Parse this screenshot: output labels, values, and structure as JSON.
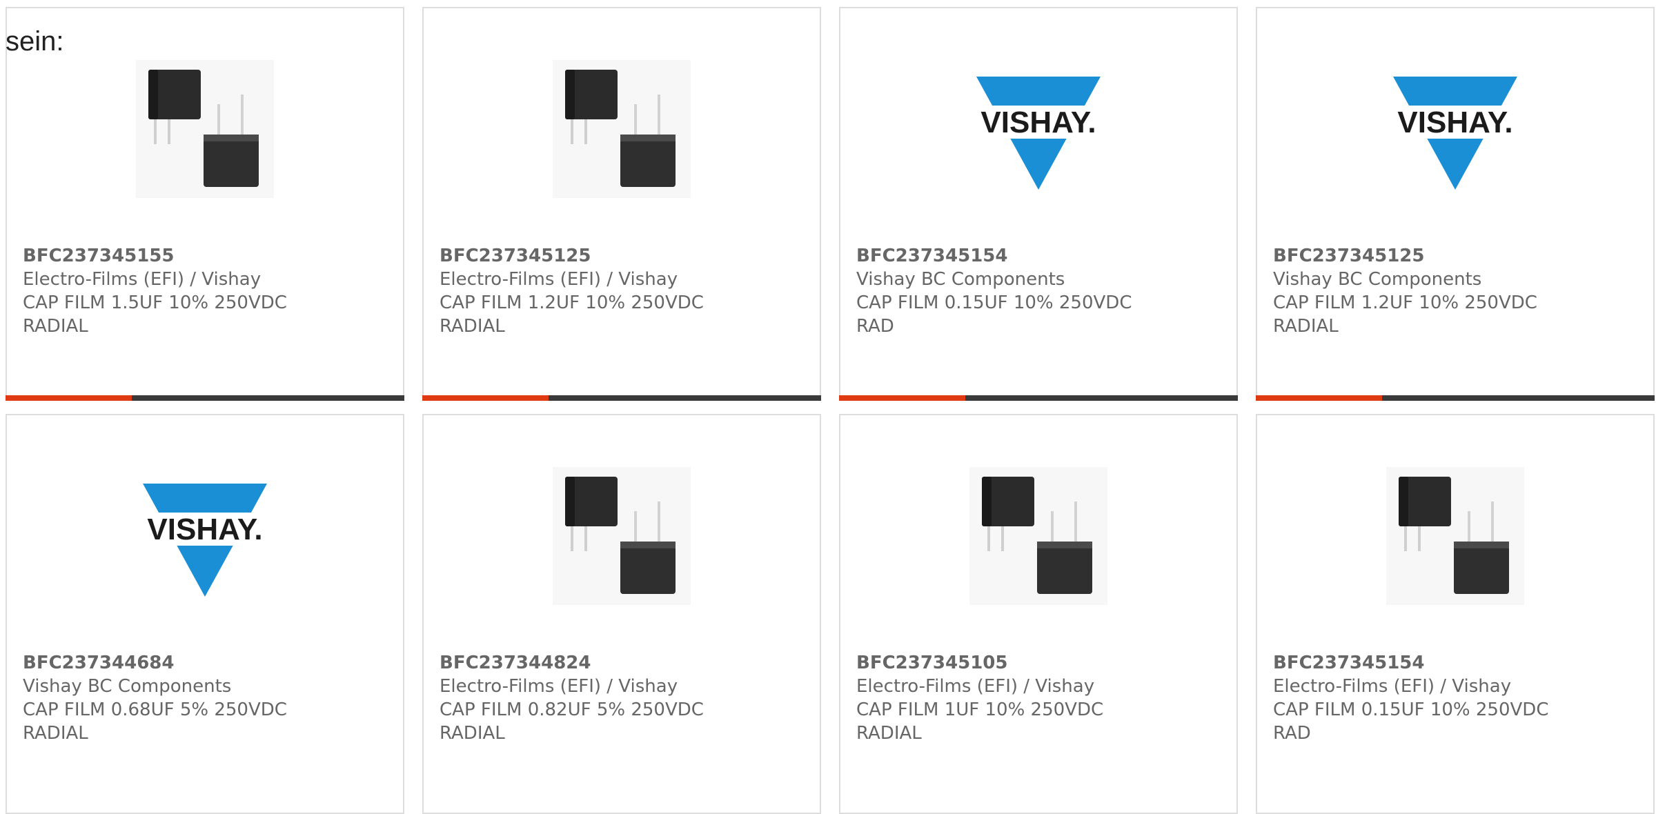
{
  "intro_text": "sein:",
  "colors": {
    "accent": "#e03a12",
    "bar": "#3a3a3a",
    "vishay_blue": "#1a8fd6"
  },
  "products": [
    {
      "part": "BFC237345155",
      "maker": "Electro-Films (EFI) / Vishay",
      "desc1": "CAP FILM 1.5UF 10% 250VDC",
      "desc2": "RADIAL",
      "image": "capacitor-photo"
    },
    {
      "part": "BFC237345125",
      "maker": "Electro-Films (EFI) / Vishay",
      "desc1": "CAP FILM 1.2UF 10% 250VDC",
      "desc2": "RADIAL",
      "image": "capacitor-photo"
    },
    {
      "part": "BFC237345154",
      "maker": "Vishay BC Components",
      "desc1": "CAP FILM 0.15UF 10% 250VDC",
      "desc2": "RAD",
      "image": "vishay-logo",
      "logo_text": "VISHAY."
    },
    {
      "part": "BFC237345125",
      "maker": "Vishay BC Components",
      "desc1": "CAP FILM 1.2UF 10% 250VDC",
      "desc2": "RADIAL",
      "image": "vishay-logo",
      "logo_text": "VISHAY."
    },
    {
      "part": "BFC237344684",
      "maker": "Vishay BC Components",
      "desc1": "CAP FILM 0.68UF 5% 250VDC",
      "desc2": "RADIAL",
      "image": "vishay-logo",
      "logo_text": "VISHAY."
    },
    {
      "part": "BFC237344824",
      "maker": "Electro-Films (EFI) / Vishay",
      "desc1": "CAP FILM 0.82UF 5% 250VDC",
      "desc2": "RADIAL",
      "image": "capacitor-photo"
    },
    {
      "part": "BFC237345105",
      "maker": "Electro-Films (EFI) / Vishay",
      "desc1": "CAP FILM 1UF 10% 250VDC",
      "desc2": "RADIAL",
      "image": "capacitor-photo"
    },
    {
      "part": "BFC237345154",
      "maker": "Electro-Films (EFI) / Vishay",
      "desc1": "CAP FILM 0.15UF 10% 250VDC",
      "desc2": "RAD",
      "image": "capacitor-photo"
    }
  ]
}
